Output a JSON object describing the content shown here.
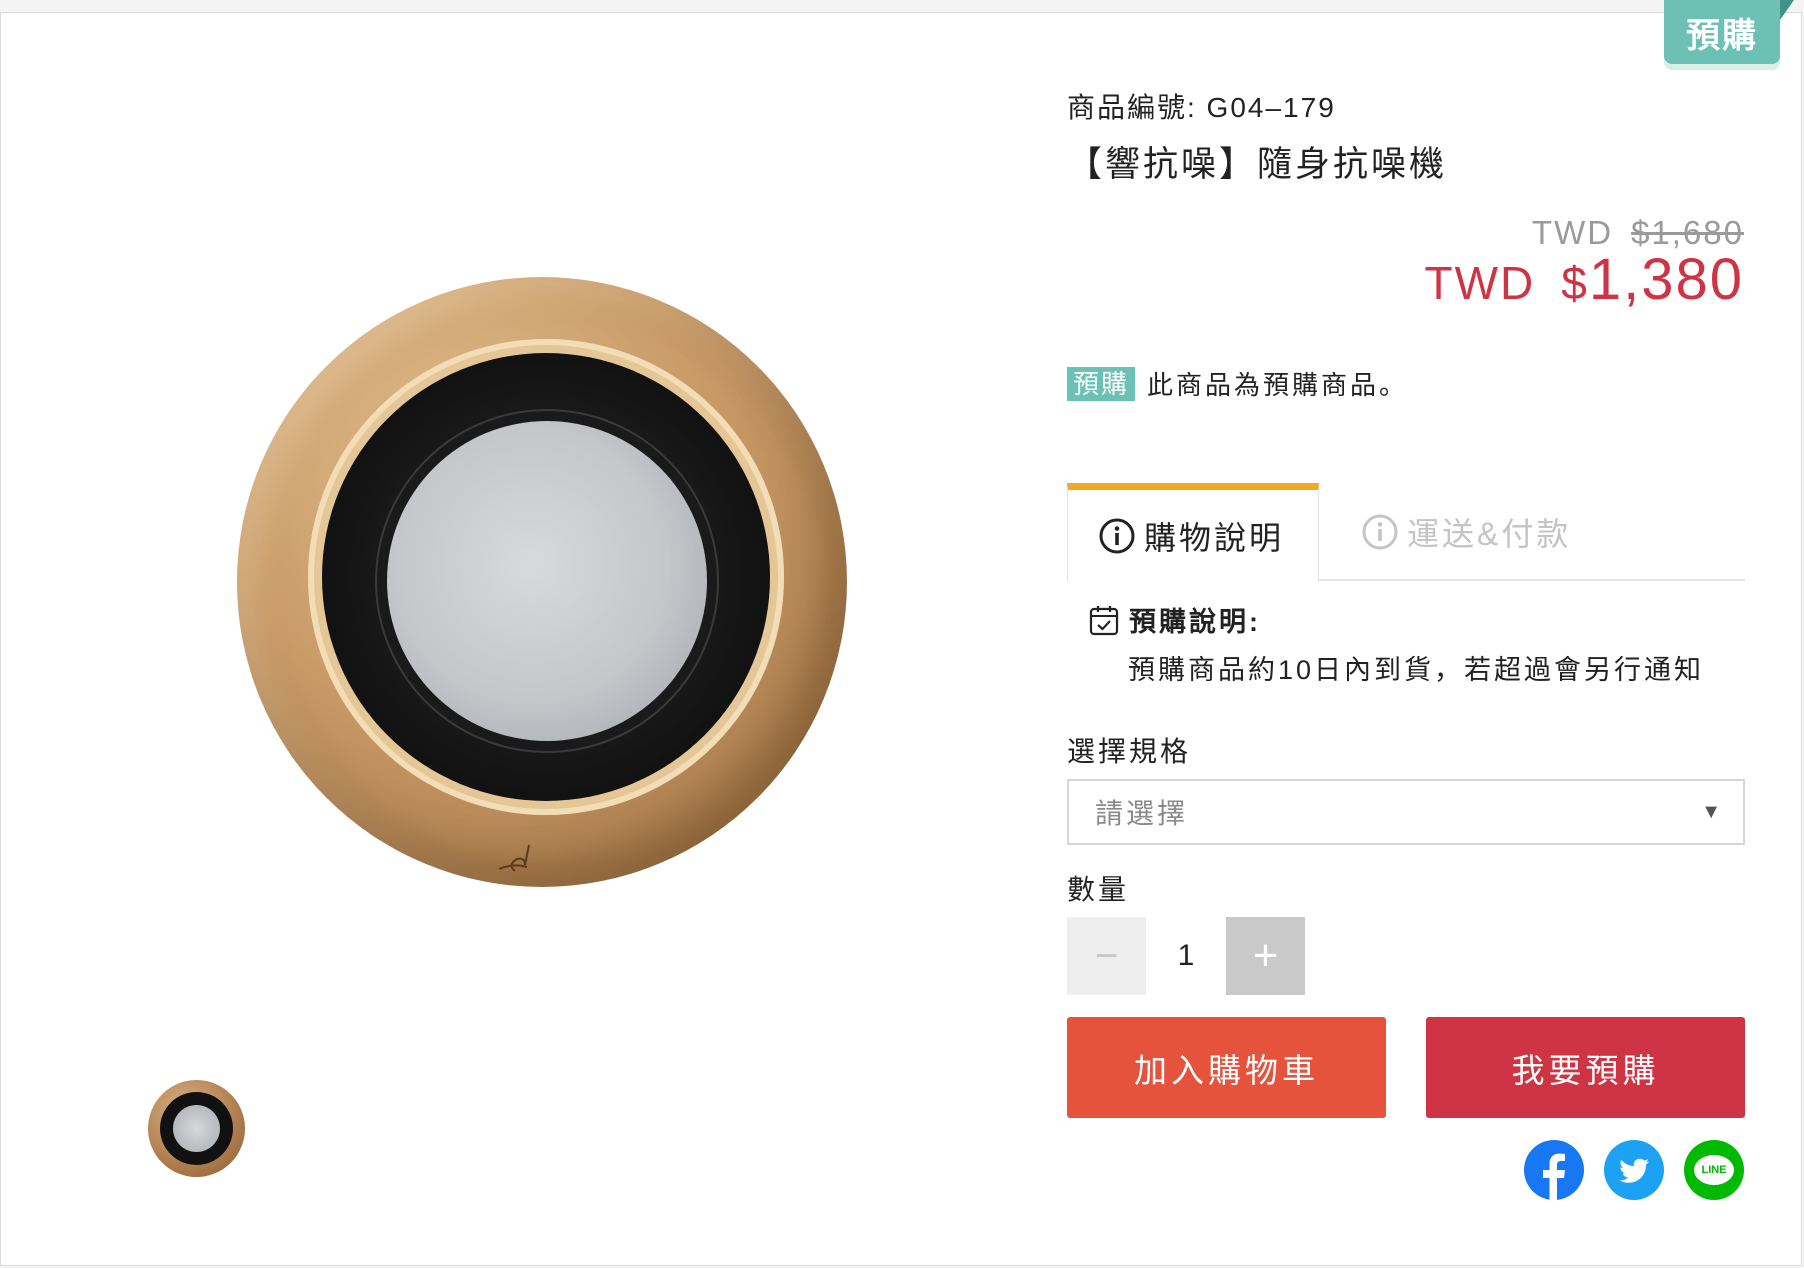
{
  "ribbon": {
    "label": "預購"
  },
  "product": {
    "sku_line": "商品編號:  G04–179",
    "title": "【響抗噪】隨身抗噪機"
  },
  "price": {
    "currency": "TWD",
    "original": "$1,680",
    "sale_symbol": "$",
    "sale": "1,380"
  },
  "notice": {
    "badge": "預購",
    "text": "此商品為預購商品。"
  },
  "tabs": [
    {
      "label": "購物說明",
      "icon": "info-circle-icon",
      "active": true
    },
    {
      "label": "運送&付款",
      "icon": "info-circle-icon",
      "active": false
    }
  ],
  "preorder": {
    "heading": "預購說明:",
    "icon": "calendar-check-icon",
    "body": "預購商品約10日內到貨，若超過會另行通知"
  },
  "spec": {
    "label": "選擇規格",
    "placeholder": "請選擇",
    "arrow": "▼"
  },
  "quantity": {
    "label": "數量",
    "value": "1",
    "minus": "−",
    "plus": "+"
  },
  "actions": {
    "add_to_cart": "加入購物車",
    "preorder": "我要預購"
  },
  "share": {
    "items": [
      {
        "name": "facebook",
        "icon": "facebook-icon"
      },
      {
        "name": "twitter",
        "icon": "twitter-icon"
      },
      {
        "name": "line",
        "icon": "line-icon",
        "text": "LINE"
      }
    ]
  },
  "colors": {
    "accent_teal": "#6cc0b4",
    "sale_red": "#cf3444",
    "cart_button": "#e5533d",
    "preorder_button": "#cf3444",
    "tab_active_border": "#f5a623",
    "facebook": "#1877f2",
    "twitter": "#1da1f2",
    "line": "#00b900"
  }
}
